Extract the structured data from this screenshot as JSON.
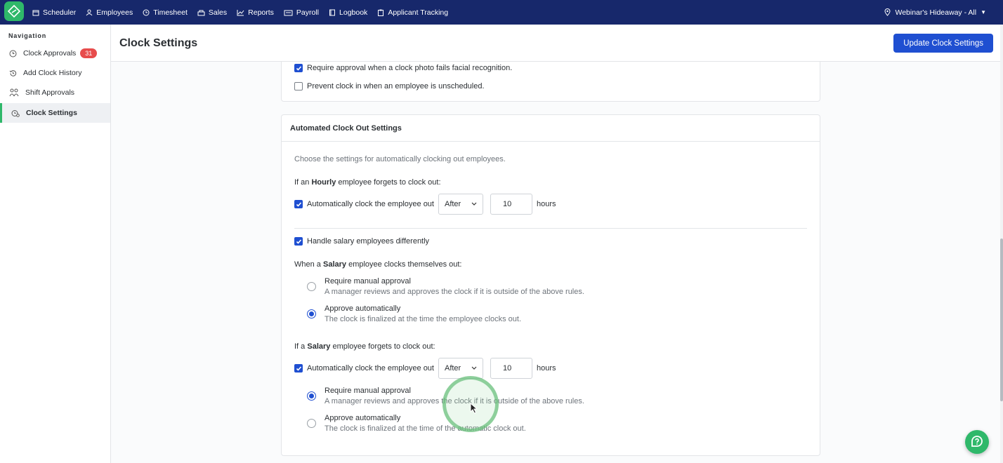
{
  "topnav": {
    "items": [
      {
        "label": "Scheduler",
        "icon": "calendar-icon"
      },
      {
        "label": "Employees",
        "icon": "person-icon"
      },
      {
        "label": "Timesheet",
        "icon": "clock-icon"
      },
      {
        "label": "Sales",
        "icon": "stack-icon"
      },
      {
        "label": "Reports",
        "icon": "chart-line-icon"
      },
      {
        "label": "Payroll",
        "icon": "payroll-icon"
      },
      {
        "label": "Logbook",
        "icon": "book-icon"
      },
      {
        "label": "Applicant Tracking",
        "icon": "clipboard-icon"
      }
    ],
    "location": "Webinar's Hideaway - All"
  },
  "sidebar": {
    "heading": "Navigation",
    "items": [
      {
        "label": "Clock Approvals",
        "badge": "31",
        "icon": "clock-icon"
      },
      {
        "label": "Add Clock History",
        "icon": "history-icon"
      },
      {
        "label": "Shift Approvals",
        "icon": "people-icon"
      },
      {
        "label": "Clock Settings",
        "icon": "clock-settings-icon",
        "active": true
      }
    ]
  },
  "header": {
    "title": "Clock Settings",
    "update_button": "Update Clock Settings"
  },
  "prev_card": {
    "opt_facial": "Require approval when a clock photo fails facial recognition.",
    "opt_unscheduled": "Prevent clock in when an employee is unscheduled."
  },
  "auto_clock_out": {
    "title": "Automated Clock Out Settings",
    "intro": "Choose the settings for automatically clocking out employees.",
    "hourly_prefix": "If an",
    "hourly_bold": "Hourly",
    "hourly_suffix": "employee forgets to clock out:",
    "auto_label": "Automatically clock the employee out",
    "after": "After",
    "hours_value": "10",
    "hours_unit": "hours",
    "salary_toggle": "Handle salary employees differently",
    "salary_self_prefix": "When a",
    "salary_bold": "Salary",
    "salary_self_suffix": "employee clocks themselves out:",
    "salary_forget_prefix": "If a",
    "salary_forget_suffix": "employee forgets to clock out:",
    "manual_title": "Require manual approval",
    "manual_desc": "A manager reviews and approves the clock if it is outside of the above rules.",
    "auto_title": "Approve automatically",
    "auto_desc_self": "The clock is finalized at the time the employee clocks out.",
    "auto_desc_forget": "The clock is finalized at the time of the automatic clock out."
  },
  "colors": {
    "nav_bg": "#17286b",
    "brand_green": "#2fb86a",
    "primary_blue": "#1f4fd1",
    "badge_red": "#e74c4c"
  }
}
